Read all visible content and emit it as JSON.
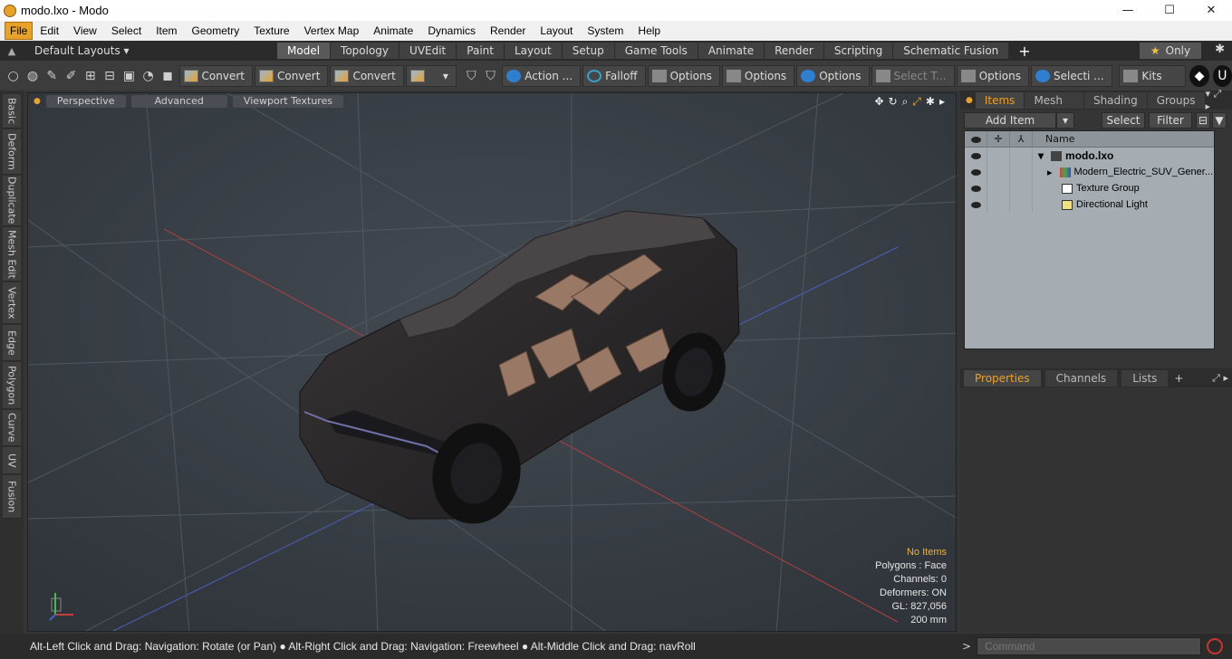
{
  "window": {
    "title": "modo.lxo - Modo",
    "minimize": "—",
    "maximize": "☐",
    "close": "✕"
  },
  "menu": [
    "File",
    "Edit",
    "View",
    "Select",
    "Item",
    "Geometry",
    "Texture",
    "Vertex Map",
    "Animate",
    "Dynamics",
    "Render",
    "Layout",
    "System",
    "Help"
  ],
  "layoutbar": {
    "layouts_label": "Default Layouts ▾",
    "tabs": [
      "Model",
      "Topology",
      "UVEdit",
      "Paint",
      "Layout",
      "Setup",
      "Game Tools",
      "Animate",
      "Render",
      "Scripting",
      "Schematic Fusion"
    ],
    "active_tab": "Model",
    "plus": "+",
    "only_label": "Only"
  },
  "toolbar": {
    "convert1": "Convert",
    "convert2": "Convert",
    "convert3": "Convert",
    "action": "Action ...",
    "falloff": "Falloff",
    "options1": "Options",
    "options2": "Options",
    "options3": "Options",
    "select_t": "Select T...",
    "options4": "Options",
    "selecti": "Selecti ...",
    "kits": "Kits"
  },
  "left_tabs": [
    "Basic",
    "Deform",
    "Duplicate",
    "Mesh Edit",
    "Vertex",
    "Edge",
    "Polygon",
    "Curve",
    "UV",
    "Fusion"
  ],
  "viewport": {
    "tabs": [
      "Perspective",
      "Advanced",
      "Viewport Textures"
    ],
    "info": {
      "items": "No Items",
      "polygons": "Polygons : Face",
      "channels": "Channels: 0",
      "deformers": "Deformers: ON",
      "gl": "GL: 827,056",
      "scale": "200 mm"
    }
  },
  "items_panel": {
    "tabs": [
      "Items",
      "Mesh ...",
      "Shading",
      "Groups"
    ],
    "add_item": "Add Item",
    "select": "Select",
    "filter": "Filter",
    "name_header": "Name",
    "rows": [
      {
        "name": "modo.lxo"
      },
      {
        "name": "Modern_Electric_SUV_Gener..."
      },
      {
        "name": "Texture Group"
      },
      {
        "name": "Directional Light"
      }
    ]
  },
  "properties_panel": {
    "tabs": [
      "Properties",
      "Channels",
      "Lists"
    ],
    "plus": "+"
  },
  "status": {
    "hint": "Alt-Left Click and Drag: Navigation: Rotate (or Pan) ● Alt-Right Click and Drag: Navigation: Freewheel ● Alt-Middle Click and Drag: navRoll",
    "command_placeholder": "Command"
  },
  "colors": {
    "accent": "#e8a22a",
    "active_tab_text": "#f0a020"
  }
}
